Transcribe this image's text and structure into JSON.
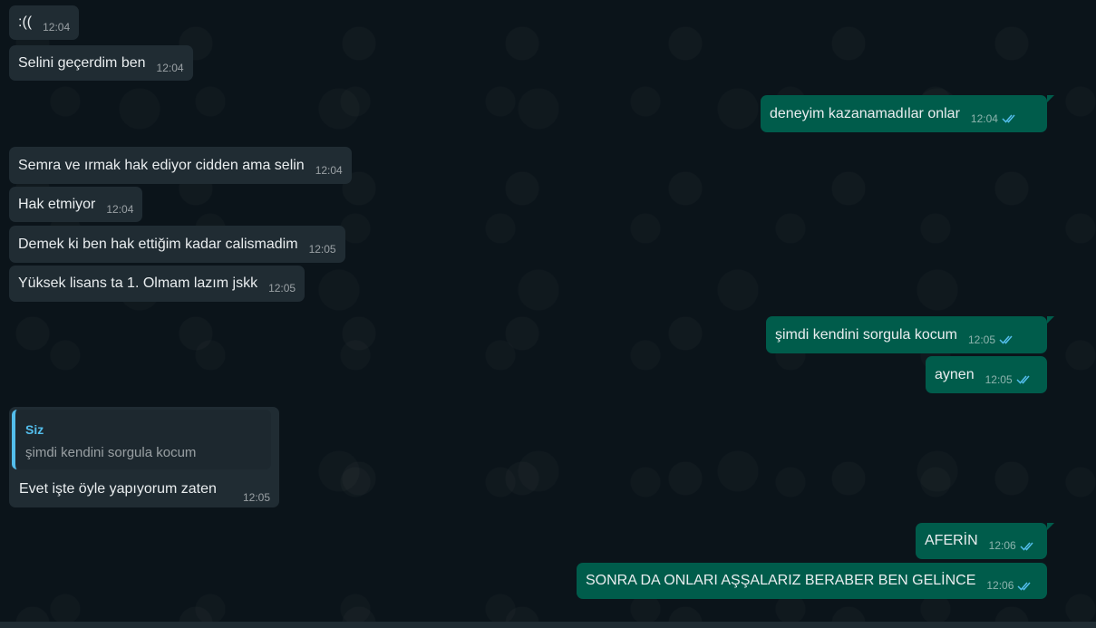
{
  "messages": [
    {
      "dir": "in",
      "text": ":((",
      "time": "12:04"
    },
    {
      "dir": "in",
      "text": "Selini geçerdim ben",
      "time": "12:04"
    },
    {
      "dir": "out",
      "text": "deneyim kazanamadılar onlar",
      "time": "12:04"
    },
    {
      "dir": "in",
      "text": "Semra ve ırmak hak ediyor cidden ama selin",
      "time": "12:04"
    },
    {
      "dir": "in",
      "text": "Hak etmiyor",
      "time": "12:04"
    },
    {
      "dir": "in",
      "text": "Demek ki ben hak ettiğim kadar calismadim",
      "time": "12:05"
    },
    {
      "dir": "in",
      "text": "Yüksek lisans ta 1. Olmam lazım jskk",
      "time": "12:05"
    },
    {
      "dir": "out",
      "text": "şimdi kendini sorgula kocum",
      "time": "12:05"
    },
    {
      "dir": "out",
      "text": "aynen",
      "time": "12:05"
    },
    {
      "dir": "out",
      "text": "AFERİN",
      "time": "12:06"
    },
    {
      "dir": "out",
      "text": "SONRA DA ONLARI AŞŞALARIZ BERABER BEN GELİNCE",
      "time": "12:06"
    }
  ],
  "reply": {
    "quoted_author": "Siz",
    "quoted_text": "şimdi kendini sorgula kocum",
    "text": "Evet işte öyle yapıyorum zaten",
    "time": "12:05"
  },
  "colors": {
    "background": "#0b141a",
    "incoming": "#202c33",
    "outgoing": "#005c4b",
    "read_ticks": "#53bdeb"
  },
  "icons": {
    "read_receipt": "double-check-icon"
  }
}
